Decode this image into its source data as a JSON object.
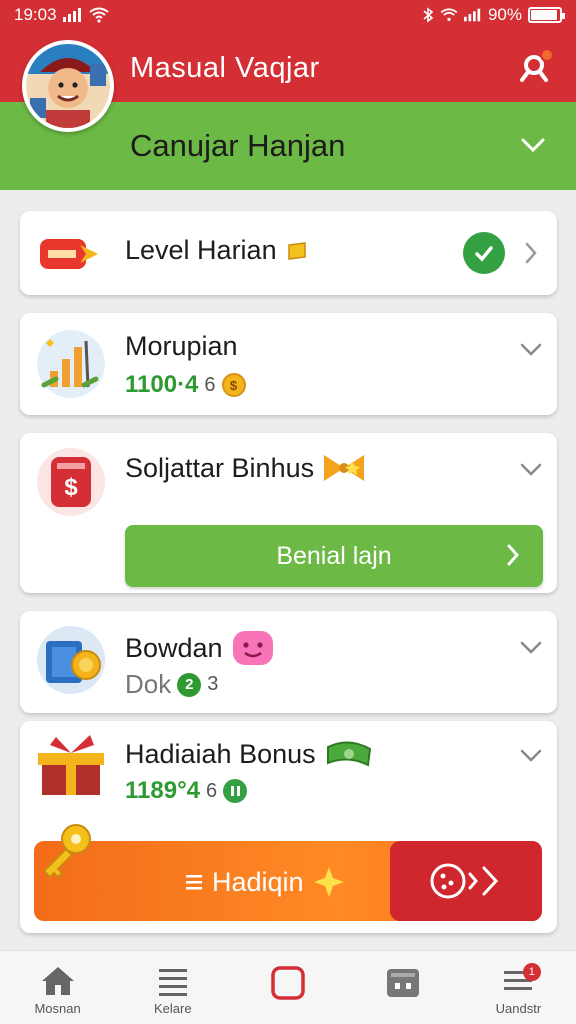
{
  "status_bar": {
    "time": "19:03",
    "battery": "90%"
  },
  "header": {
    "title": "Masual Vaqjar"
  },
  "subheader": {
    "title": "Canujar Hanjan"
  },
  "cards": [
    {
      "title": "Level Harian"
    },
    {
      "title": "Morupian",
      "value": "1100·4",
      "count": "6"
    },
    {
      "title": "Soljattar Binhus",
      "button_label": "Benial lajn"
    },
    {
      "title": "Bowdan",
      "sub_label": "Dok",
      "sub_badge": "2",
      "sub_count": "3"
    },
    {
      "title": "Hadiaiah Bonus",
      "value": "1189°4",
      "count": "6",
      "button_label": "Hadiqin"
    }
  ],
  "bottom_nav": [
    {
      "label": "Mosnan"
    },
    {
      "label": "Kelare"
    },
    {
      "label": ""
    },
    {
      "label": ""
    },
    {
      "label": "Uandstr",
      "badge": "1"
    }
  ],
  "colors": {
    "red": "#d42f34",
    "green": "#6cb945",
    "orange": "#f36c19"
  },
  "icons": [
    "signal-icon",
    "wifi-icon",
    "bluetooth-icon",
    "battery-icon",
    "notification-icon",
    "chevron-down-icon",
    "chevron-right-icon",
    "check-icon",
    "coin-icon",
    "home-icon",
    "list-icon",
    "square-icon",
    "wallet-icon",
    "menu-icon"
  ]
}
